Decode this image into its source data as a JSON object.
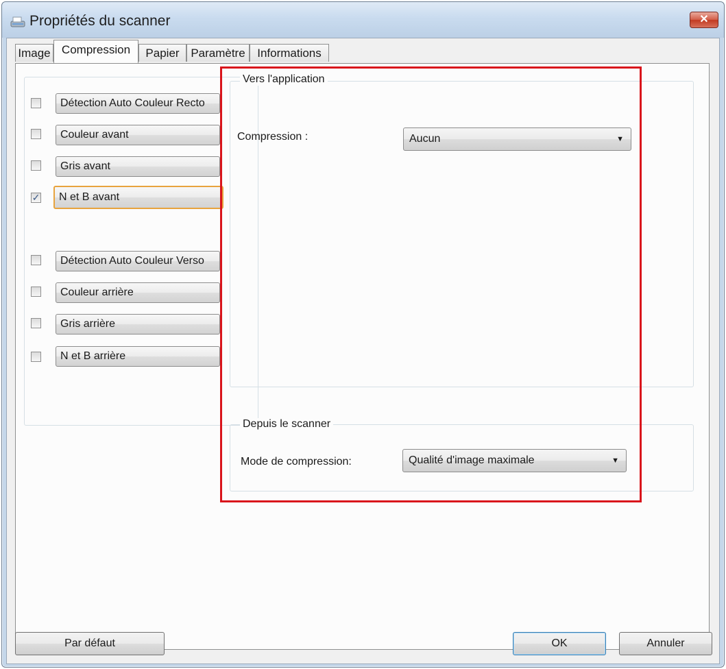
{
  "window": {
    "title": "Propriétés du scanner",
    "close_label": "✕"
  },
  "tabs": [
    {
      "label": "Image"
    },
    {
      "label": "Compression"
    },
    {
      "label": "Papier"
    },
    {
      "label": "Paramètre"
    },
    {
      "label": "Informations"
    }
  ],
  "active_tab": "Compression",
  "image_types": [
    {
      "label": "Détection Auto Couleur Recto",
      "checked": false
    },
    {
      "label": "Couleur avant",
      "checked": false
    },
    {
      "label": "Gris avant",
      "checked": false
    },
    {
      "label": "N et B avant",
      "checked": true
    },
    {
      "label": "Détection Auto Couleur Verso",
      "checked": false
    },
    {
      "label": "Couleur arrière",
      "checked": false
    },
    {
      "label": "Gris arrière",
      "checked": false
    },
    {
      "label": "N et B arrière",
      "checked": false
    }
  ],
  "to_application": {
    "title": "Vers l'application",
    "compression_label": "Compression :",
    "compression_value": "Aucun"
  },
  "from_scanner": {
    "title": "Depuis le scanner",
    "mode_label": "Mode de compression:",
    "mode_value": "Qualité d'image maximale"
  },
  "buttons": {
    "default_label": "Par défaut",
    "ok_label": "OK",
    "cancel_label": "Annuler"
  },
  "colors": {
    "highlight": "#d9141b",
    "selected_border": "#e8a33d",
    "close_button": "#c23a22"
  }
}
